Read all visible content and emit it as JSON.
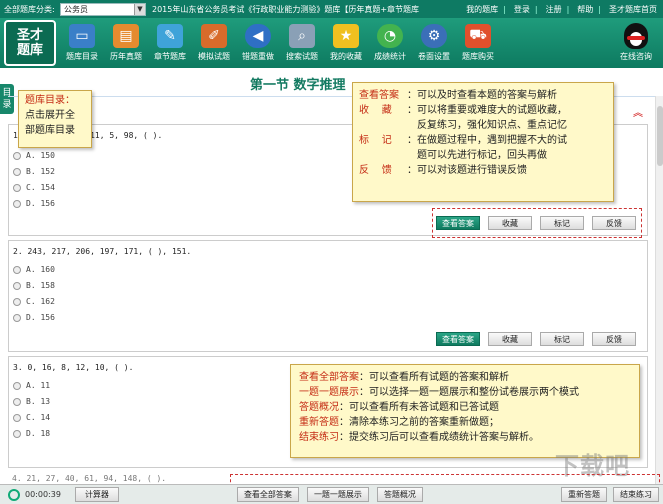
{
  "topbar": {
    "category_label": "全部题库分类:",
    "category_value": "公务员",
    "exam_title": "2015年山东省公务员考试《行政职业能力测验》题库【历年真题+章节题库",
    "links": [
      "我的题库",
      "登录",
      "注册",
      "帮助",
      "圣才题库首页"
    ]
  },
  "logo": {
    "line1": "圣才",
    "line2": "题库"
  },
  "toolbar": [
    {
      "label": "题库目录",
      "icon": "monitor-icon",
      "color": "#3a7fc8"
    },
    {
      "label": "历年真题",
      "icon": "book-icon",
      "color": "#e58b2f"
    },
    {
      "label": "章节题库",
      "icon": "notebook-icon",
      "color": "#3fa3d9"
    },
    {
      "label": "模拟试题",
      "icon": "pencil-paper-icon",
      "color": "#d86b2b"
    },
    {
      "label": "错题重做",
      "icon": "back-arrow-icon",
      "color": "#2f6fc5"
    },
    {
      "label": "搜索试题",
      "icon": "search-icon",
      "color": "#8aa0b6"
    },
    {
      "label": "我的收藏",
      "icon": "bookmark-icon",
      "color": "#f0c020"
    },
    {
      "label": "成绩统计",
      "icon": "chart-icon",
      "color": "#43b34f"
    },
    {
      "label": "卷面设置",
      "icon": "gear-icon",
      "color": "#3b6fb8"
    },
    {
      "label": "题库购买",
      "icon": "cart-icon",
      "color": "#e0502c"
    }
  ],
  "consult_label": "在线咨询",
  "side_tab": {
    "line1": "目",
    "line2": "录"
  },
  "section_title": "第一节  数字推理",
  "questions": [
    {
      "text": "1. 157, 65, 27, 11, 5, 98, (     ).",
      "options": [
        "A.  150",
        "B.  152",
        "C.  154",
        "D.  156"
      ]
    },
    {
      "text": "2. 243, 217, 206, 197, 171, (     ), 151.",
      "options": [
        "A.  160",
        "B.  158",
        "C.  162",
        "D.  156"
      ]
    },
    {
      "text": "3. 0, 16, 8, 12, 10, (     ).",
      "options": [
        "A.  11",
        "B.  13",
        "C.  14",
        "D.  18"
      ]
    },
    {
      "text": "4. 21, 27, 40, 61, 94, 148, (     )."
    }
  ],
  "question_actions": {
    "view_answer": "查看答案",
    "favorite": "收藏",
    "mark": "标记",
    "feedback": "反馈"
  },
  "callouts": {
    "toc": {
      "title": "题库目录：",
      "line2": "点击展开全",
      "line3": "部题库目录"
    },
    "answer_help": [
      {
        "key": "查看答案",
        "text": "：可以及时查看本题的答案与解析"
      },
      {
        "key": "收    藏",
        "text": "：可以将重要或难度大的试题收藏，"
      },
      {
        "key": "",
        "text": "反复练习，强化知识点、重点记忆"
      },
      {
        "key": "标    记",
        "text": "：在做题过程中，遇到把握不大的试"
      },
      {
        "key": "",
        "text": "题可以先进行标记，回头再做"
      },
      {
        "key": "反    馈",
        "text": "：可以对该题进行错误反馈"
      }
    ],
    "bottom_help": [
      {
        "key": "查看全部答案",
        "text": "：可以查看所有试题的答案和解析"
      },
      {
        "key": "一题一题展示",
        "text": "：可以选择一题一题展示和整份试卷展示两个模式"
      },
      {
        "key": "答题概况",
        "text": "：可以查看所有未答试题和已答试题"
      },
      {
        "key": "重新答题",
        "text": "：清除本练习之前的答案重新做题；"
      },
      {
        "key": "结束练习",
        "text": "：提交练习后可以查看成绩统计答案与解析。"
      }
    ]
  },
  "bottombar": {
    "timer": "00:00:39",
    "calculator": "计算器",
    "view_all": "查看全部答案",
    "one_by_one": "一题一题展示",
    "overview": "答题概况",
    "redo": "重新答题",
    "finish": "结束练习"
  },
  "watermark": "下载吧"
}
